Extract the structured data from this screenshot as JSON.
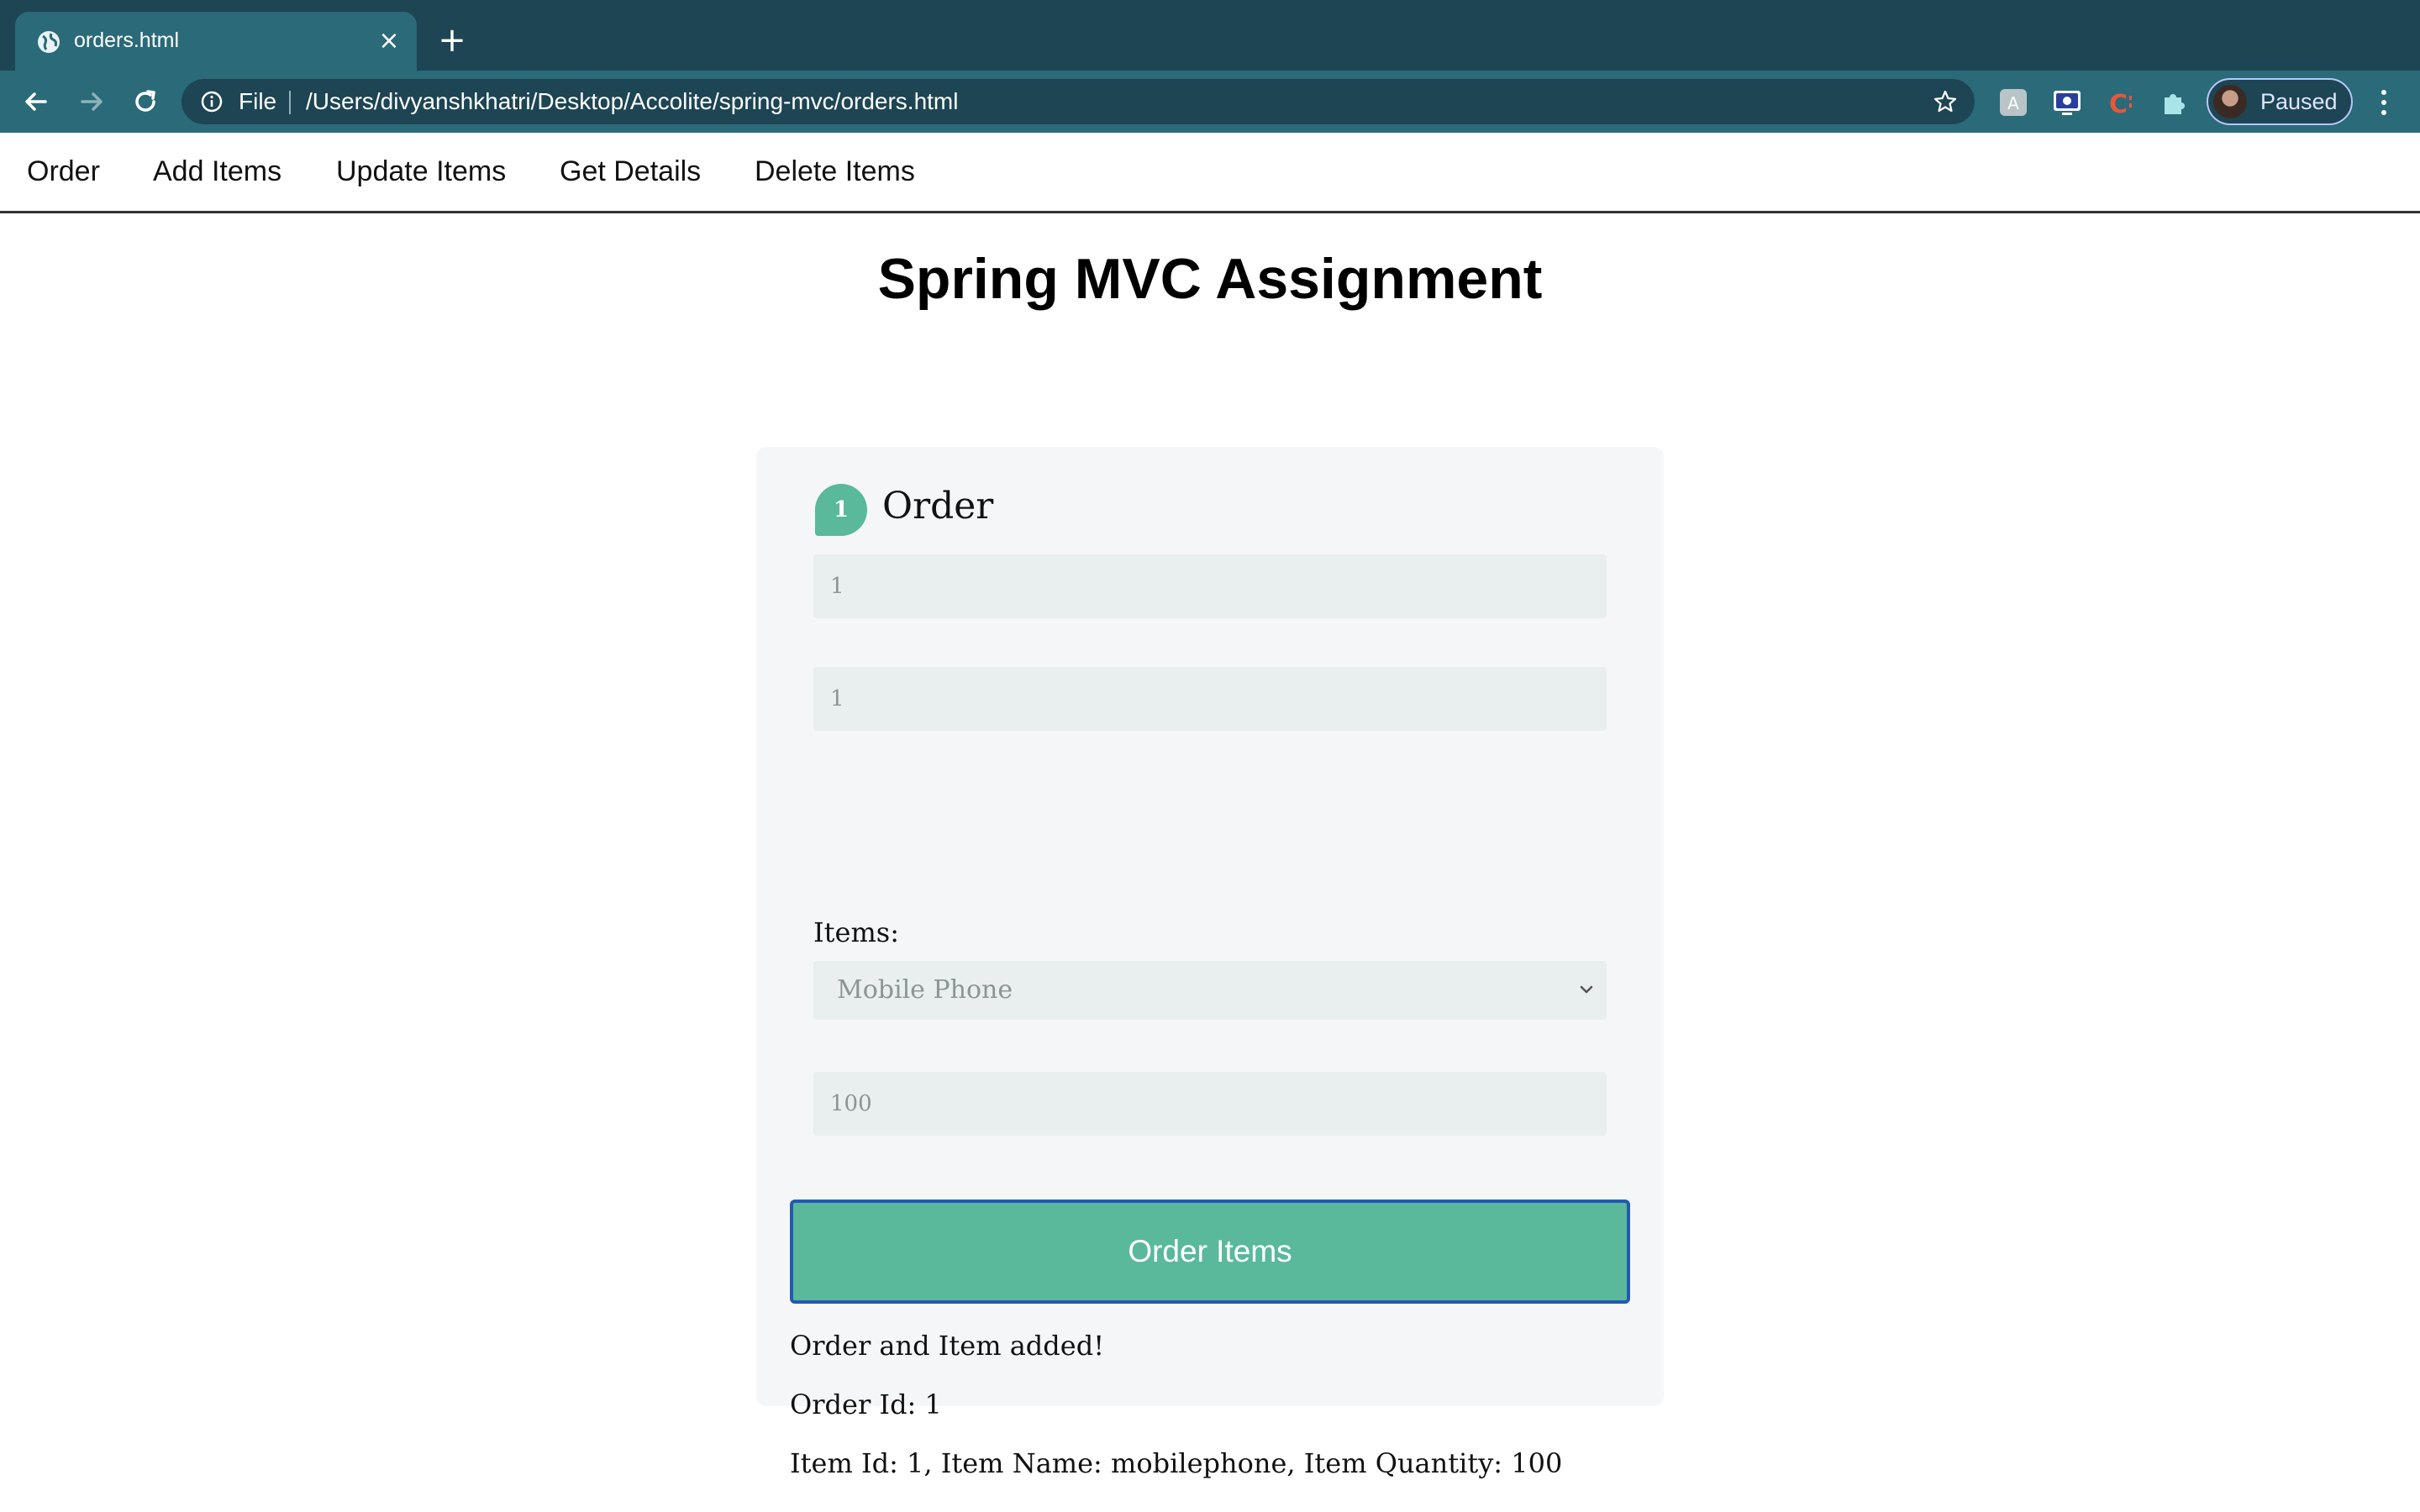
{
  "browser": {
    "tab_title": "orders.html",
    "scheme_label": "File",
    "url": "/Users/divyanshkhatri/Desktop/Accolite/spring-mvc/orders.html",
    "profile_label": "Paused",
    "icons": [
      "globe-icon",
      "close-icon",
      "new-tab-icon",
      "back-icon",
      "forward-icon",
      "reload-icon",
      "info-icon",
      "star-icon",
      "extension-icons",
      "puzzle-icon",
      "kebab-menu-icon"
    ]
  },
  "nav": {
    "items": [
      {
        "label": "Order"
      },
      {
        "label": "Add Items"
      },
      {
        "label": "Update Items"
      },
      {
        "label": "Get Details"
      },
      {
        "label": "Delete Items"
      }
    ]
  },
  "page": {
    "title": "Spring MVC Assignment"
  },
  "form": {
    "step_number": "1",
    "step_title": "Order",
    "order_id_value": "1",
    "item_id_value": "1",
    "items_label": "Items:",
    "selected_item": "Mobile Phone",
    "quantity_value": "100",
    "submit_label": "Order Items"
  },
  "result": {
    "message": "Order and Item added!",
    "order_line": "Order Id: 1",
    "item_line": "Item Id: 1, Item Name: mobilephone, Item Quantity: 100"
  },
  "colors": {
    "accent": "#5ab99b",
    "chrome_dark": "#1d4553",
    "chrome_light": "#2b6a78",
    "card_bg": "#f5f6f7",
    "input_bg": "#e9eeee",
    "focus_ring": "#2458b5"
  }
}
